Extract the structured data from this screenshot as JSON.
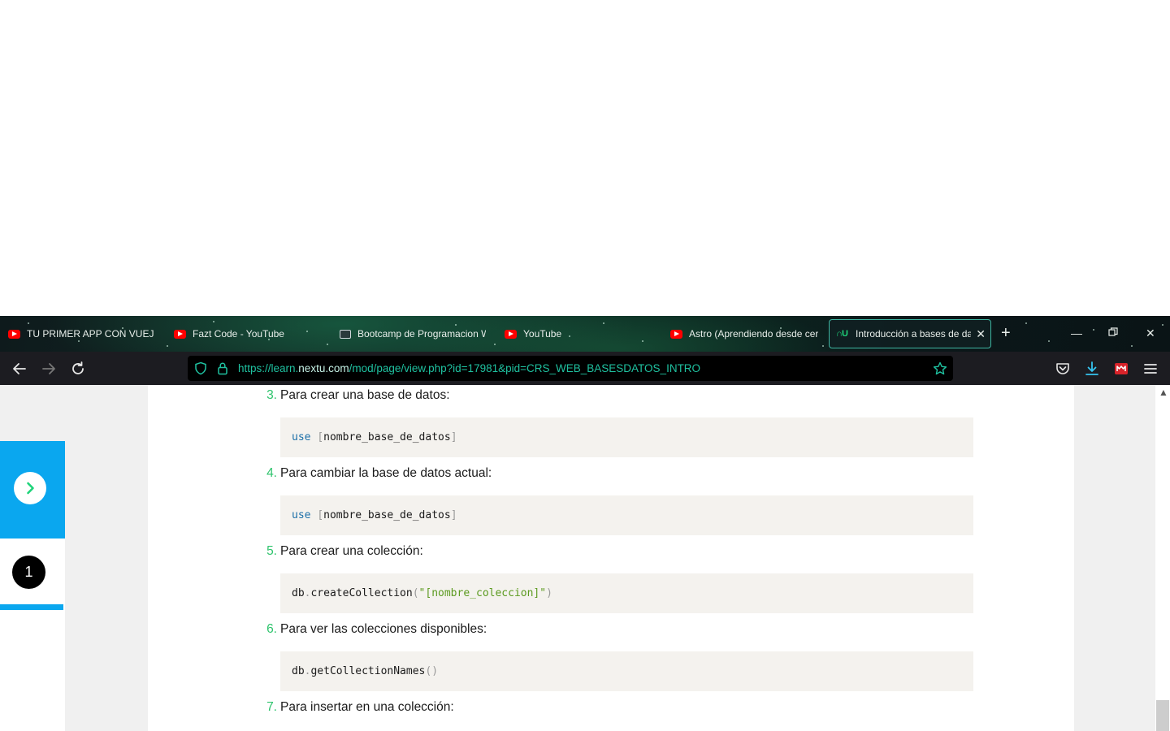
{
  "tabs": [
    {
      "title": "TU PRIMER APP CON VUEJS -",
      "icon": "youtube-icon"
    },
    {
      "title": "Fazt Code - YouTube",
      "icon": "youtube-icon"
    },
    {
      "title": "Bootcamp de Programacion W",
      "icon": "bootcamp-icon"
    },
    {
      "title": "YouTube",
      "icon": "youtube-icon"
    },
    {
      "title": "Astro (Aprendiendo desde cer",
      "icon": "youtube-icon"
    },
    {
      "title": "Introducción a bases de dat",
      "icon": "nextu-icon",
      "active": true
    }
  ],
  "navbar": {
    "url_prefix": "https://learn.",
    "url_host": "nextu.com",
    "url_path": "/mod/page/view.php?id=17981&pid=CRS_WEB_BASESDATOS_INTRO"
  },
  "sidepanel": {
    "step_number": "1"
  },
  "steps": [
    {
      "n": "3.",
      "text": "Para crear una base de datos:"
    },
    {
      "n": "4.",
      "text": "Para cambiar la base de datos actual:"
    },
    {
      "n": "5.",
      "text": "Para crear una colección:"
    },
    {
      "n": "6.",
      "text": "Para ver las colecciones disponibles:"
    },
    {
      "n": "7.",
      "text": "Para insertar en una colección:"
    }
  ],
  "code": [
    {
      "kw": "use",
      "p1": "[",
      "arg": "nombre_base_de_datos",
      "p2": "]"
    },
    {
      "kw": "use",
      "p1": "[",
      "arg": "nombre_base_de_datos",
      "p2": "]"
    },
    {
      "obj": "db",
      "dot": ".",
      "fn": "createCollection",
      "p1": "(",
      "str": "\"[nombre_coleccion]\"",
      "p2": ")"
    },
    {
      "obj": "db",
      "dot": ".",
      "fn": "getCollectionNames",
      "p1": "()"
    }
  ],
  "colors": {
    "accent_green": "#2cc36b",
    "side_blue": "#0aa7ef",
    "keyword": "#1b6fa8",
    "string": "#5b9a1f"
  }
}
